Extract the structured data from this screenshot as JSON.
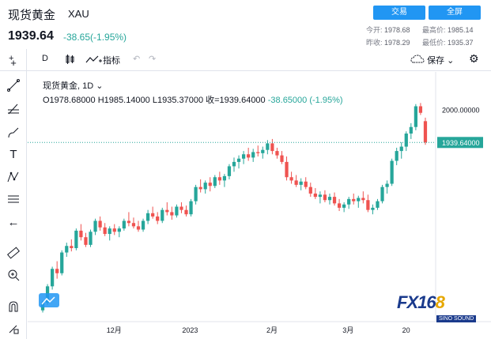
{
  "header": {
    "title": "现货黄金",
    "symbol": "XAU",
    "price": "1939.64",
    "change": "-38.65(-1.95%)",
    "trade_btn": "交易",
    "full_btn": "全屏",
    "open_label": "今开:",
    "open_value": "1978.68",
    "high_label": "最高价:",
    "high_value": "1985.14",
    "prevclose_label": "昨收:",
    "prevclose_value": "1978.29",
    "low_label": "最低价:",
    "low_value": "1935.37"
  },
  "toolbar": {
    "interval": "D",
    "indicators": "指标",
    "save": "保存"
  },
  "legend": {
    "name": "现货黄金, 1D",
    "ohlc": "O1978.68000  H1985.14000  L1935.37000  收=1939.64000",
    "chg": "-38.65000 (-1.95%)"
  },
  "axis": {
    "price_tick": "2000.00000",
    "last_price": "1939.64000",
    "x_ticks": [
      "12月",
      "2023",
      "2月",
      "3月",
      "20"
    ]
  },
  "colors": {
    "up": "#26a69a",
    "down": "#ef5350",
    "accent": "#2196f3"
  },
  "chart_data": {
    "type": "candlestick",
    "title": "现货黄金, 1D",
    "ylim": [
      1620,
      2040
    ],
    "x_ticks": [
      "12月",
      "2023",
      "2月",
      "3月",
      "20"
    ],
    "candles": [
      [
        1632,
        1650,
        1628,
        1646
      ],
      [
        1646,
        1680,
        1642,
        1676
      ],
      [
        1676,
        1712,
        1670,
        1708
      ],
      [
        1708,
        1722,
        1690,
        1700
      ],
      [
        1700,
        1742,
        1696,
        1738
      ],
      [
        1738,
        1756,
        1730,
        1750
      ],
      [
        1750,
        1762,
        1740,
        1746
      ],
      [
        1746,
        1782,
        1742,
        1778
      ],
      [
        1778,
        1790,
        1760,
        1766
      ],
      [
        1766,
        1774,
        1748,
        1752
      ],
      [
        1752,
        1780,
        1748,
        1776
      ],
      [
        1776,
        1800,
        1770,
        1796
      ],
      [
        1796,
        1804,
        1778,
        1784
      ],
      [
        1784,
        1792,
        1768,
        1772
      ],
      [
        1772,
        1786,
        1760,
        1782
      ],
      [
        1782,
        1790,
        1770,
        1776
      ],
      [
        1776,
        1786,
        1766,
        1782
      ],
      [
        1782,
        1800,
        1778,
        1796
      ],
      [
        1796,
        1812,
        1786,
        1792
      ],
      [
        1792,
        1802,
        1782,
        1786
      ],
      [
        1786,
        1796,
        1776,
        1780
      ],
      [
        1780,
        1800,
        1776,
        1796
      ],
      [
        1796,
        1816,
        1790,
        1810
      ],
      [
        1810,
        1822,
        1800,
        1804
      ],
      [
        1804,
        1812,
        1790,
        1796
      ],
      [
        1796,
        1820,
        1792,
        1816
      ],
      [
        1816,
        1830,
        1806,
        1812
      ],
      [
        1812,
        1822,
        1798,
        1806
      ],
      [
        1806,
        1826,
        1802,
        1822
      ],
      [
        1822,
        1830,
        1810,
        1816
      ],
      [
        1816,
        1824,
        1804,
        1808
      ],
      [
        1808,
        1836,
        1804,
        1832
      ],
      [
        1832,
        1862,
        1826,
        1858
      ],
      [
        1858,
        1872,
        1848,
        1854
      ],
      [
        1854,
        1870,
        1846,
        1866
      ],
      [
        1866,
        1876,
        1850,
        1860
      ],
      [
        1860,
        1880,
        1856,
        1876
      ],
      [
        1876,
        1886,
        1862,
        1870
      ],
      [
        1870,
        1882,
        1858,
        1878
      ],
      [
        1878,
        1900,
        1872,
        1896
      ],
      [
        1896,
        1912,
        1886,
        1904
      ],
      [
        1904,
        1916,
        1892,
        1910
      ],
      [
        1910,
        1924,
        1900,
        1918
      ],
      [
        1918,
        1930,
        1906,
        1912
      ],
      [
        1912,
        1928,
        1904,
        1922
      ],
      [
        1922,
        1934,
        1914,
        1920
      ],
      [
        1920,
        1932,
        1910,
        1926
      ],
      [
        1926,
        1944,
        1918,
        1938
      ],
      [
        1938,
        1946,
        1918,
        1924
      ],
      [
        1924,
        1930,
        1910,
        1916
      ],
      [
        1916,
        1924,
        1900,
        1904
      ],
      [
        1904,
        1914,
        1870,
        1876
      ],
      [
        1876,
        1886,
        1864,
        1870
      ],
      [
        1870,
        1880,
        1858,
        1862
      ],
      [
        1862,
        1874,
        1852,
        1868
      ],
      [
        1868,
        1876,
        1854,
        1858
      ],
      [
        1858,
        1866,
        1840,
        1846
      ],
      [
        1846,
        1856,
        1836,
        1840
      ],
      [
        1840,
        1850,
        1828,
        1844
      ],
      [
        1844,
        1852,
        1830,
        1834
      ],
      [
        1834,
        1846,
        1826,
        1840
      ],
      [
        1840,
        1848,
        1824,
        1828
      ],
      [
        1828,
        1836,
        1814,
        1820
      ],
      [
        1820,
        1830,
        1812,
        1826
      ],
      [
        1826,
        1840,
        1818,
        1836
      ],
      [
        1836,
        1846,
        1826,
        1832
      ],
      [
        1832,
        1842,
        1820,
        1838
      ],
      [
        1838,
        1850,
        1828,
        1834
      ],
      [
        1834,
        1844,
        1812,
        1816
      ],
      [
        1816,
        1826,
        1808,
        1820
      ],
      [
        1820,
        1836,
        1816,
        1832
      ],
      [
        1832,
        1862,
        1828,
        1858
      ],
      [
        1858,
        1870,
        1846,
        1864
      ],
      [
        1864,
        1910,
        1860,
        1906
      ],
      [
        1906,
        1930,
        1898,
        1924
      ],
      [
        1924,
        1940,
        1910,
        1932
      ],
      [
        1932,
        1960,
        1924,
        1956
      ],
      [
        1956,
        1975,
        1946,
        1968
      ],
      [
        1968,
        2010,
        1962,
        2006
      ],
      [
        2006,
        2012,
        1990,
        1994
      ],
      [
        1978.68,
        1985.14,
        1935.37,
        1939.64
      ]
    ]
  }
}
